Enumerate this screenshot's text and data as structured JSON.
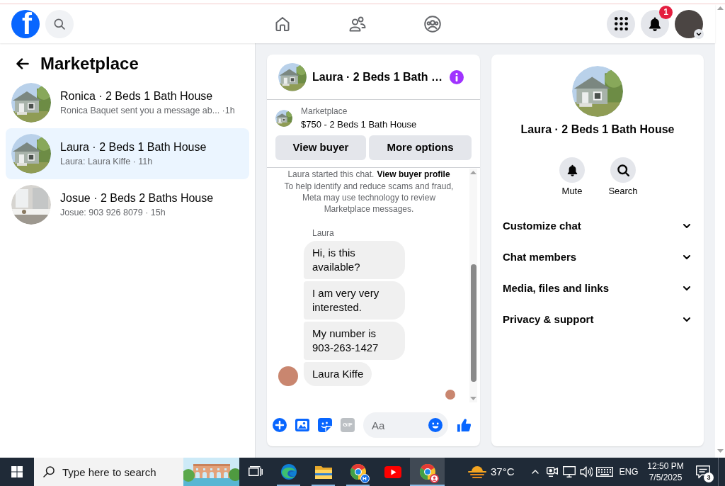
{
  "header": {
    "logo": "f",
    "notification_badge": "1"
  },
  "sidebar": {
    "title": "Marketplace",
    "conversations": [
      {
        "kind": "exterior",
        "title": "Ronica · 2 Beds 1 Bath House",
        "subtitle": "Ronica Baquet sent you a message ab... ·1h",
        "selected": false
      },
      {
        "kind": "exterior",
        "title": "Laura · 2 Beds 1 Bath House",
        "subtitle": "Laura: Laura Kiffe · 11h",
        "selected": true
      },
      {
        "kind": "interior",
        "title": "Josue · 2 Beds 2 Baths House",
        "subtitle": "Josue: 903 926 8079 · 15h",
        "selected": false
      }
    ]
  },
  "chat": {
    "title": "Laura · 2 Beds 1 Bath …",
    "listing": {
      "source": "Marketplace",
      "summary": "$750 - 2 Beds 1 Bath House"
    },
    "buttons": [
      "View buyer",
      "More options"
    ],
    "intro": {
      "text": "Laura started this chat.",
      "link": "View buyer profile"
    },
    "notice": "To help identify and reduce scams and fraud, Meta may use technology to review Marketplace messages.",
    "sender": "Laura",
    "messages": [
      "Hi, is this available?",
      "I am very very interested.",
      "My number is 903-263-1427",
      "Laura Kiffe"
    ],
    "composer": {
      "gif_label": "GIF",
      "placeholder": "Aa"
    }
  },
  "details": {
    "title": "Laura · 2 Beds 1 Bath House",
    "actions": [
      {
        "kind": "mute",
        "label": "Mute"
      },
      {
        "kind": "search",
        "label": "Search"
      }
    ],
    "sections": [
      {
        "label": "Customize chat",
        "expanded": false
      },
      {
        "label": "Chat members",
        "expanded": false
      },
      {
        "label": "Media, files and links",
        "expanded": false
      },
      {
        "label": "Privacy & support",
        "expanded": false
      }
    ]
  },
  "taskbar": {
    "search": {
      "placeholder": "Type here to search"
    },
    "apps": [
      {
        "kind": "edge",
        "running": true,
        "selected": false
      },
      {
        "kind": "folder",
        "running": true,
        "selected": false
      },
      {
        "kind": "chrome",
        "badge": "H",
        "running": true,
        "selected": false
      },
      {
        "kind": "video",
        "running": false,
        "selected": false
      },
      {
        "kind": "chrome",
        "photo_badge": true,
        "running": true,
        "selected": true
      }
    ],
    "weather": "37°C",
    "language": "ENG",
    "time": "12:50 PM",
    "date": "7/5/2025",
    "notification_count": "3"
  }
}
